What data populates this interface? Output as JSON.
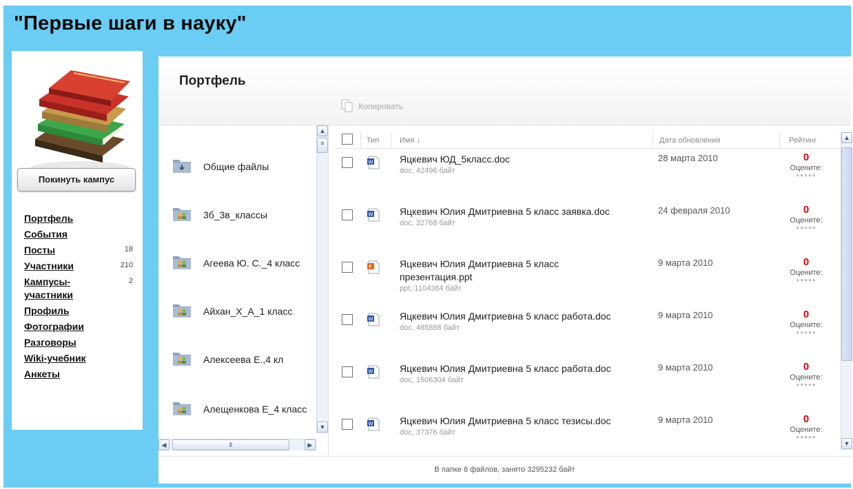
{
  "site": {
    "title": "\"Первые шаги в науку\""
  },
  "sidebar": {
    "leave_button": "Покинуть кампус",
    "nav": [
      {
        "label": "Портфель",
        "count": ""
      },
      {
        "label": "События",
        "count": ""
      },
      {
        "label": "Посты",
        "count": "18"
      },
      {
        "label": "Участники",
        "count": "210"
      },
      {
        "label": "Кампусы-участники",
        "count": "2"
      },
      {
        "label": "Профиль",
        "count": ""
      },
      {
        "label": "Фотографии",
        "count": ""
      },
      {
        "label": "Разговоры",
        "count": ""
      },
      {
        "label": "Wiki-учебник",
        "count": ""
      },
      {
        "label": "Анкеты",
        "count": ""
      }
    ]
  },
  "main": {
    "title": "Портфель",
    "copy_label": "Копировать",
    "folders": [
      {
        "name": "Общие файлы",
        "icon": "shared-folder-icon"
      },
      {
        "name": "3б_3в_классы",
        "icon": "group-folder-icon"
      },
      {
        "name": "Агеева Ю. С._4 класс",
        "icon": "group-folder-icon"
      },
      {
        "name": "Айхан_Х_А_1 класс",
        "icon": "group-folder-icon"
      },
      {
        "name": "Алексеева Е.,4 кл",
        "icon": "group-folder-icon"
      },
      {
        "name": "Алещенкова Е_4 класс",
        "icon": "group-folder-icon"
      }
    ],
    "table": {
      "headers": {
        "type": "Тип",
        "name": "Имя ↓",
        "date": "Дата обновления",
        "rating": "Рейтинг"
      },
      "rows": [
        {
          "type": "word-doc-icon",
          "name": "Яцкевич ЮД_5класс.doc",
          "meta": "doc, 42496 байт",
          "date": "28 марта 2010",
          "rating": "0",
          "rate_label": "Оцените:"
        },
        {
          "type": "word-doc-icon",
          "name": "Яцкевич Юлия Дмитриевна 5 класс заявка.doc",
          "meta": "doc, 32768 байт",
          "date": "24 февраля 2010",
          "rating": "0",
          "rate_label": "Оцените:"
        },
        {
          "type": "powerpoint-icon",
          "name": "Яцкевич Юлия Дмитриевна 5 класс презентация.ppt",
          "meta": "ppt, 1104384 байт",
          "date": "9 марта 2010",
          "rating": "0",
          "rate_label": "Оцените:"
        },
        {
          "type": "word-doc-icon",
          "name": "Яцкевич Юлия Дмитриевна 5 класс работа.doc",
          "meta": "doc, 485888 байт",
          "date": "9 марта 2010",
          "rating": "0",
          "rate_label": "Оцените:"
        },
        {
          "type": "word-doc-icon",
          "name": "Яцкевич Юлия Дмитриевна 5 класс работа.doc",
          "meta": "doc, 1506304 байт",
          "date": "9 марта 2010",
          "rating": "0",
          "rate_label": "Оцените:"
        },
        {
          "type": "word-doc-icon",
          "name": "Яцкевич Юлия Дмитриевна 5 класс тезисы.doc",
          "meta": "doc, 37376 байт",
          "date": "9 марта 2010",
          "rating": "0",
          "rate_label": "Оцените:"
        }
      ]
    },
    "footer": "В папке 8 файлов, занято 3295232 байт"
  },
  "colors": {
    "background": "#6bcdf3",
    "rating": "#e00000"
  }
}
